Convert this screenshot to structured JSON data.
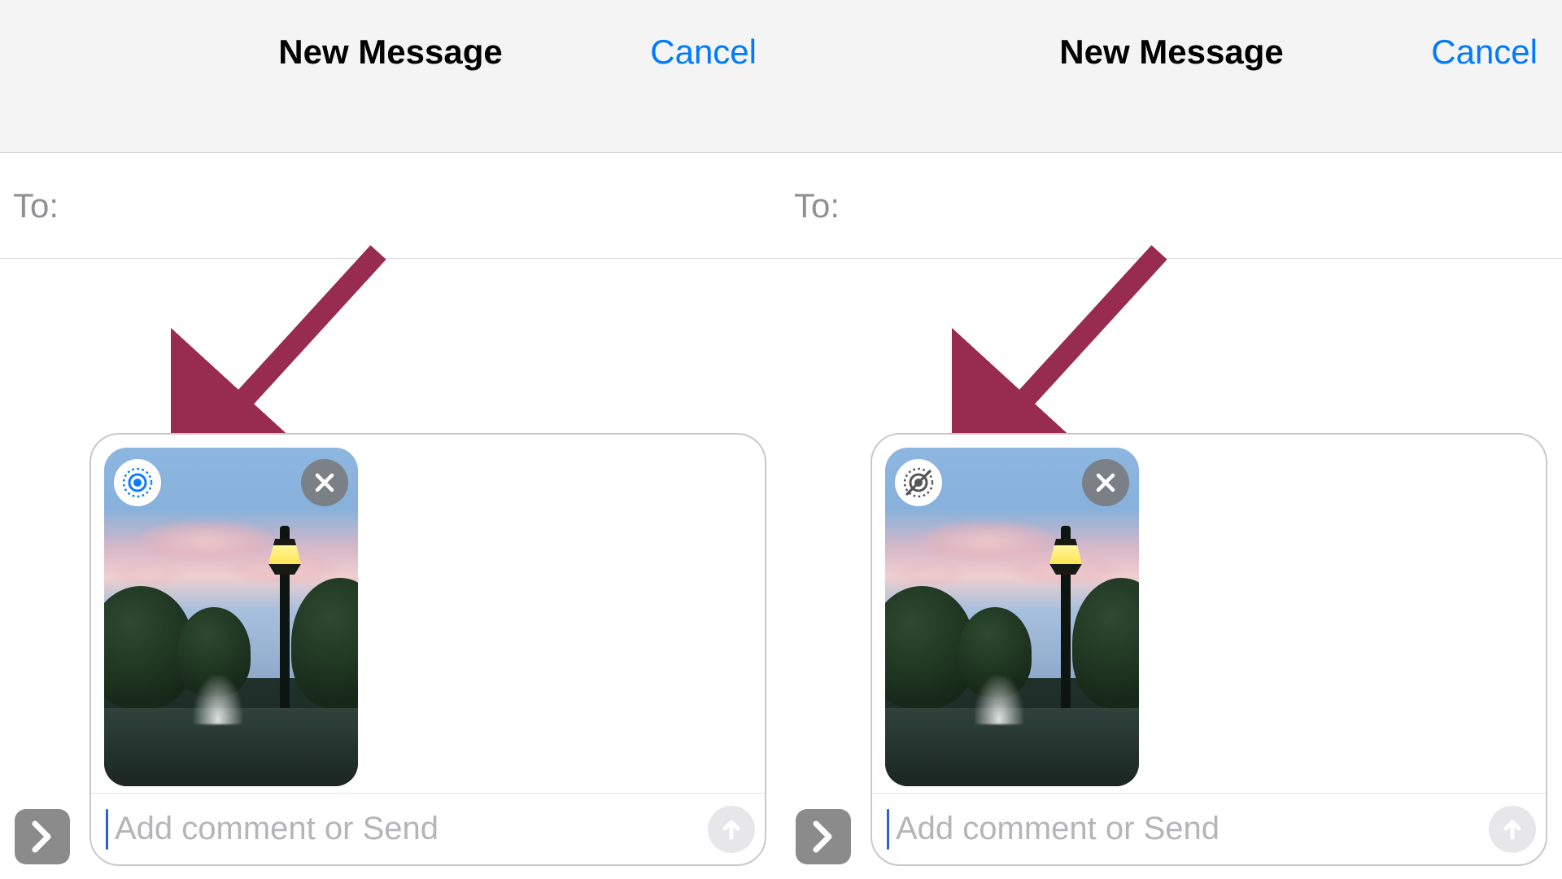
{
  "panes": [
    {
      "title": "New Message",
      "cancel_label": "Cancel",
      "to_label": "To:",
      "message_placeholder": "Add comment or Send",
      "live_photo_state": "on"
    },
    {
      "title": "New Message",
      "cancel_label": "Cancel",
      "to_label": "To:",
      "message_placeholder": "Add comment or Send",
      "live_photo_state": "off"
    }
  ],
  "colors": {
    "accent": "#007aff",
    "annotation_arrow": "#982b50"
  }
}
